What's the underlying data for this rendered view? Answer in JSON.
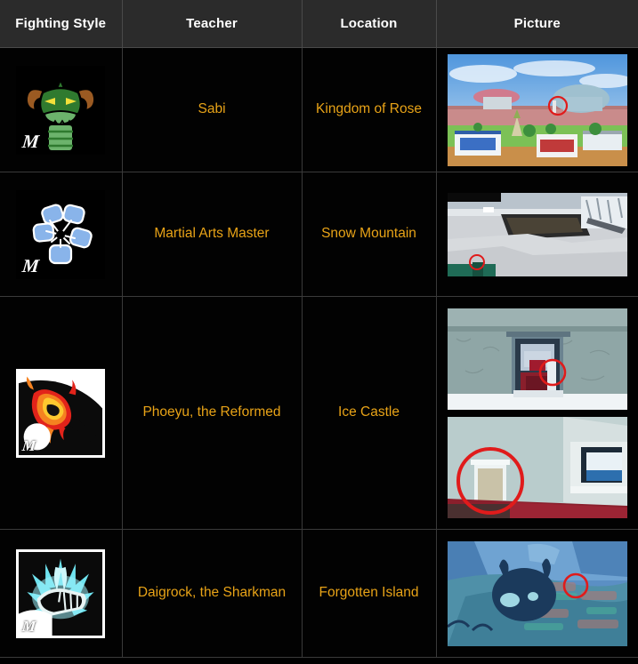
{
  "table": {
    "headers": [
      "Fighting Style",
      "Teacher",
      "Location",
      "Picture"
    ],
    "rows": [
      {
        "fighting_style_icon": "green-dragon-head-icon",
        "watermark": "M",
        "teacher": "Sabi",
        "location": "Kingdom of Rose",
        "pictures": [
          "kingdom-of-rose-city-screenshot"
        ]
      },
      {
        "fighting_style_icon": "blue-five-fists-icon",
        "watermark": "M",
        "teacher": "Martial Arts Master",
        "location": "Snow Mountain",
        "pictures": [
          "snow-mountain-pond-screenshot"
        ]
      },
      {
        "fighting_style_icon": "flaming-fist-icon",
        "watermark": "M",
        "teacher": "Phoeyu, the Reformed",
        "location": "Ice Castle",
        "pictures": [
          "ice-castle-entrance-screenshot",
          "ice-castle-interior-screenshot"
        ]
      },
      {
        "fighting_style_icon": "cyan-energy-fist-icon",
        "watermark": "M",
        "teacher": "Daigrock, the Sharkman",
        "location": "Forgotten Island",
        "pictures": [
          "forgotten-island-skull-screenshot"
        ]
      }
    ]
  },
  "colors": {
    "header_background": "#2b2b2b",
    "header_text": "#ffffff",
    "cell_background": "#020202",
    "cell_text": "#e8a317",
    "grid_line": "#3a3a3a",
    "annotation_circle": "#e01b1b"
  }
}
